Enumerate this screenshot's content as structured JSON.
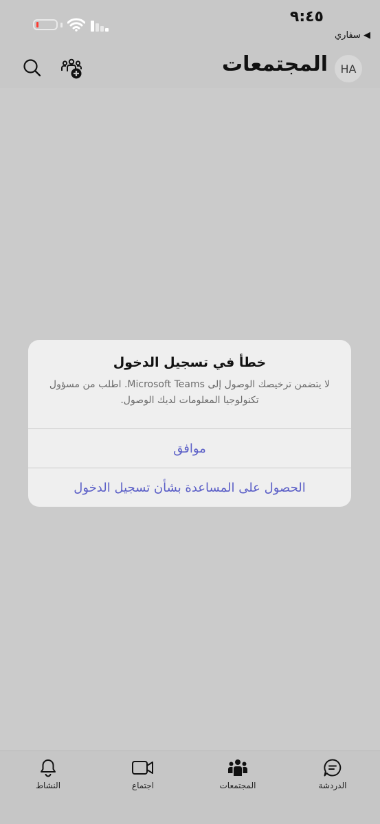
{
  "status_bar": {
    "time": "٩:٤٥",
    "back_app": "◀ سفاري",
    "battery_color": "#ff3b30"
  },
  "header": {
    "avatar_initials": "HA",
    "title": "المجتمعات",
    "icons": [
      "search-icon",
      "new-community-icon"
    ]
  },
  "dialog": {
    "title": "خطأ في تسجيل الدخول",
    "message": "لا يتضمن ترخيصك الوصول إلى Microsoft Teams. اطلب من مسؤول تكنولوجيا المعلومات لديك الوصول.",
    "ok_label": "موافق",
    "help_label": "الحصول على المساعدة بشأن تسجيل الدخول",
    "accent_color": "#5b5fc7"
  },
  "tabs": [
    {
      "label": "الدردشة",
      "icon": "chat-icon"
    },
    {
      "label": "المجتمعات",
      "icon": "communities-icon",
      "active": true
    },
    {
      "label": "اجتماع",
      "icon": "video-icon"
    },
    {
      "label": "النشاط",
      "icon": "bell-icon"
    }
  ]
}
